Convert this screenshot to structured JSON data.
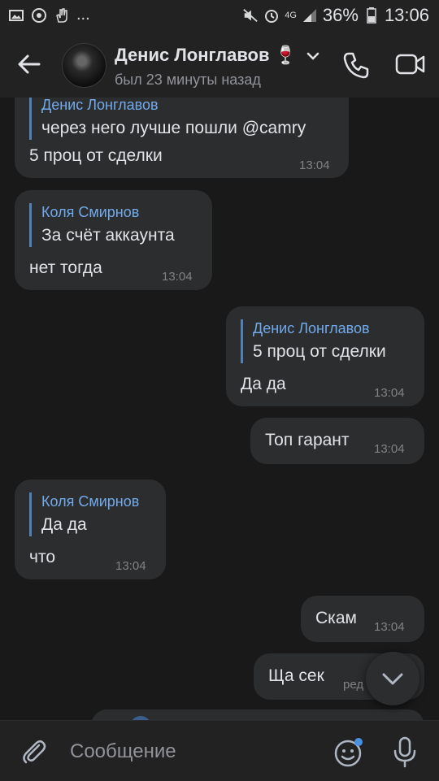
{
  "status_bar": {
    "battery": "36%",
    "time": "13:06",
    "network": "4G",
    "more": "..."
  },
  "header": {
    "name": "Денис Лонглавов",
    "name_emoji": "🍷",
    "last_seen": "был 23 минуты назад"
  },
  "messages": [
    {
      "quote_author": "Денис Лонглавов",
      "quote_text": "через него лучше пошли @camry",
      "text": "5 проц от сделки",
      "time": "13:04"
    },
    {
      "quote_author": "Коля Смирнов",
      "quote_text": "За счёт аккаунта",
      "text": "нет тогда",
      "time": "13:04"
    },
    {
      "quote_author": "Денис Лонглавов",
      "quote_text": "5 проц от сделки",
      "text": "Да да",
      "time": "13:04"
    },
    {
      "text": "Топ гарант",
      "time": "13:04"
    },
    {
      "quote_author": "Коля Смирнов",
      "quote_text": "Да да",
      "text": "что",
      "time": "13:04"
    },
    {
      "text": "Скам",
      "time": "13:04"
    },
    {
      "text": "Ща сек",
      "time": "ред"
    }
  ],
  "input": {
    "placeholder": "Сообщение"
  },
  "colors": {
    "background": "#19191a",
    "bubble": "#2c2d2e",
    "accent": "#71aaeb",
    "quote_bar": "#5181b8"
  }
}
